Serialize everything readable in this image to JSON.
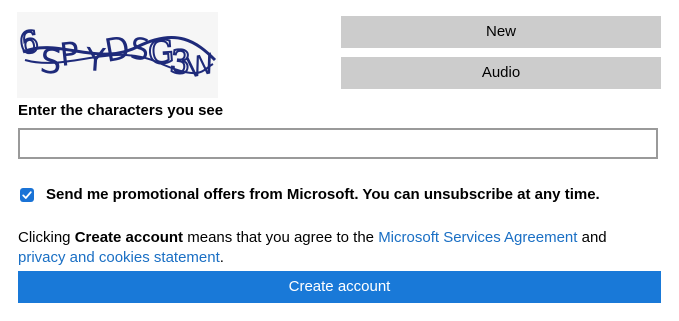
{
  "captcha": {
    "image_text": "6SPYDSG3W",
    "ink_color": "#1e2a7a"
  },
  "buttons": {
    "new_label": "New",
    "audio_label": "Audio",
    "create_label": "Create account"
  },
  "prompt": {
    "label": "Enter the characters you see",
    "input_value": ""
  },
  "promo": {
    "checked": true,
    "label": "Send me promotional offers from Microsoft. You can unsubscribe at any time."
  },
  "agreement": {
    "prefix": "Clicking ",
    "bold": "Create account",
    "middle": " means that you agree to the ",
    "link1": "Microsoft Services Agreement",
    "and": " and",
    "link2": "privacy and cookies statement",
    "end": "."
  },
  "colors": {
    "primary": "#1979d8",
    "link": "#1a6fc4",
    "secondary_button": "#cccccc",
    "checkbox": "#1a73d6"
  }
}
